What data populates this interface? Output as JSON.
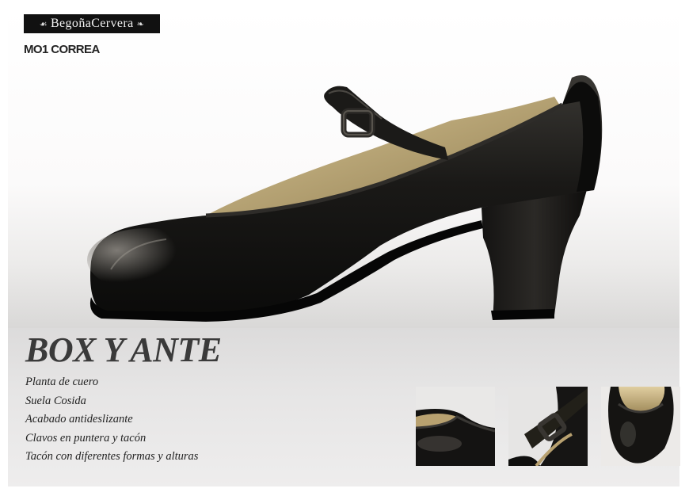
{
  "brand": {
    "name": "BegoñaCervera",
    "ornament_left": "☙",
    "ornament_right": "❧"
  },
  "product": {
    "model": "MO1 CORREA",
    "title": "BOX Y ANTE",
    "features": [
      "Planta de cuero",
      "Suela Cosida",
      "Acabado antideslizante",
      "Clavos en puntera y tacón",
      "Tacón con diferentes formas y alturas"
    ]
  },
  "thumbnails": [
    {
      "name": "toe-detail"
    },
    {
      "name": "strap-buckle-detail"
    },
    {
      "name": "front-view"
    }
  ],
  "colors": {
    "logo_bg": "#111111",
    "leather": "#151413",
    "lining": "#bda87a",
    "title": "#3a3a3a"
  }
}
